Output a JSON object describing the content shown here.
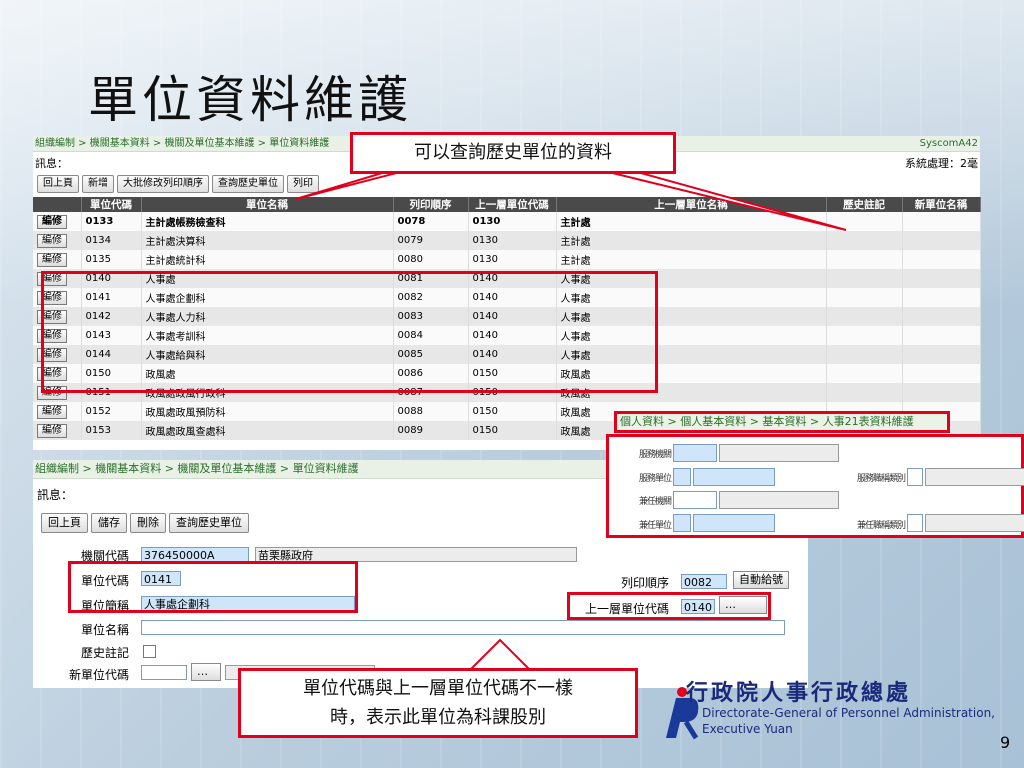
{
  "slide": {
    "title": "單位資料維護",
    "page_number": "9"
  },
  "top_panel": {
    "breadcrumb": "組織編制 > 機關基本資料 > 機關及單位基本維護 > 單位資料維護",
    "system_code": "SyscomA42",
    "message_label": "訊息：",
    "system_status": "系統處理：2毫",
    "buttons": [
      "回上頁",
      "新增",
      "大批修改列印順序",
      "查詢歷史單位",
      "列印"
    ],
    "columns": [
      "",
      "單位代碼",
      "單位名稱",
      "列印順序",
      "上一層單位代碼",
      "上一層單位名稱",
      "歷史註記",
      "新單位名稱"
    ],
    "edit_label": "編修",
    "rows": [
      {
        "code": "0133",
        "name": "主計處帳務檢查科",
        "order": "0078",
        "parent_code": "0130",
        "parent_name": "主計處",
        "bold": true
      },
      {
        "code": "0134",
        "name": "主計處決算科",
        "order": "0079",
        "parent_code": "0130",
        "parent_name": "主計處"
      },
      {
        "code": "0135",
        "name": "主計處統計科",
        "order": "0080",
        "parent_code": "0130",
        "parent_name": "主計處"
      },
      {
        "code": "0140",
        "name": "人事處",
        "order": "0081",
        "parent_code": "0140",
        "parent_name": "人事處"
      },
      {
        "code": "0141",
        "name": "人事處企劃科",
        "order": "0082",
        "parent_code": "0140",
        "parent_name": "人事處"
      },
      {
        "code": "0142",
        "name": "人事處人力科",
        "order": "0083",
        "parent_code": "0140",
        "parent_name": "人事處"
      },
      {
        "code": "0143",
        "name": "人事處考訓科",
        "order": "0084",
        "parent_code": "0140",
        "parent_name": "人事處"
      },
      {
        "code": "0144",
        "name": "人事處給與科",
        "order": "0085",
        "parent_code": "0140",
        "parent_name": "人事處"
      },
      {
        "code": "0150",
        "name": "政風處",
        "order": "0086",
        "parent_code": "0150",
        "parent_name": "政風處"
      },
      {
        "code": "0151",
        "name": "政風處政風行政科",
        "order": "0087",
        "parent_code": "0150",
        "parent_name": "政風處"
      },
      {
        "code": "0152",
        "name": "政風處政風預防科",
        "order": "0088",
        "parent_code": "0150",
        "parent_name": "政風處"
      },
      {
        "code": "0153",
        "name": "政風處政風查處科",
        "order": "0089",
        "parent_code": "0150",
        "parent_name": "政風處"
      }
    ]
  },
  "callout_top": "可以查詢歷史單位的資料",
  "bottom_panel": {
    "breadcrumb": "組織編制 > 機關基本資料 > 機關及單位基本維護 > 單位資料維護",
    "message_label": "訊息：",
    "buttons": [
      "回上頁",
      "儲存",
      "刪除",
      "查詢歷史單位"
    ],
    "fields": {
      "agency_code_label": "機關代碼",
      "agency_code": "376450000A",
      "agency_name": "苗栗縣政府",
      "unit_code_label": "單位代碼",
      "unit_code": "0141",
      "unit_abbr_label": "單位簡稱",
      "unit_abbr": "人事處企劃科",
      "unit_name_label": "單位名稱",
      "history_label": "歷史註記",
      "new_unit_code_label": "新單位代碼",
      "print_order_label": "列印順序",
      "print_order": "0082",
      "auto_number_button": "自動給號",
      "parent_code_label": "上一層單位代碼",
      "parent_code": "0140",
      "lookup_button": "…"
    }
  },
  "overlay": {
    "breadcrumb": "個人資料 > 個人基本資料 > 基本資料 > 人事21表資料維護",
    "labels": [
      "服務機關",
      "服務單位",
      "服務職稱類別",
      "兼任機關",
      "兼任單位",
      "兼任職稱類別"
    ]
  },
  "callout_bottom": {
    "line1": "單位代碼與上一層單位代碼不一樣",
    "line2": "時，表示此單位為科課股別"
  },
  "logo": {
    "chinese": "行政院人事行政總處",
    "english_line1": "Directorate-General of Personnel Administration,",
    "english_line2": "Executive Yuan"
  },
  "colors": {
    "highlight": "#e0001b",
    "header": "#4a4a4a",
    "breadcrumb_green": "#2a6e2a",
    "input_blue": "#cfe6fa"
  }
}
